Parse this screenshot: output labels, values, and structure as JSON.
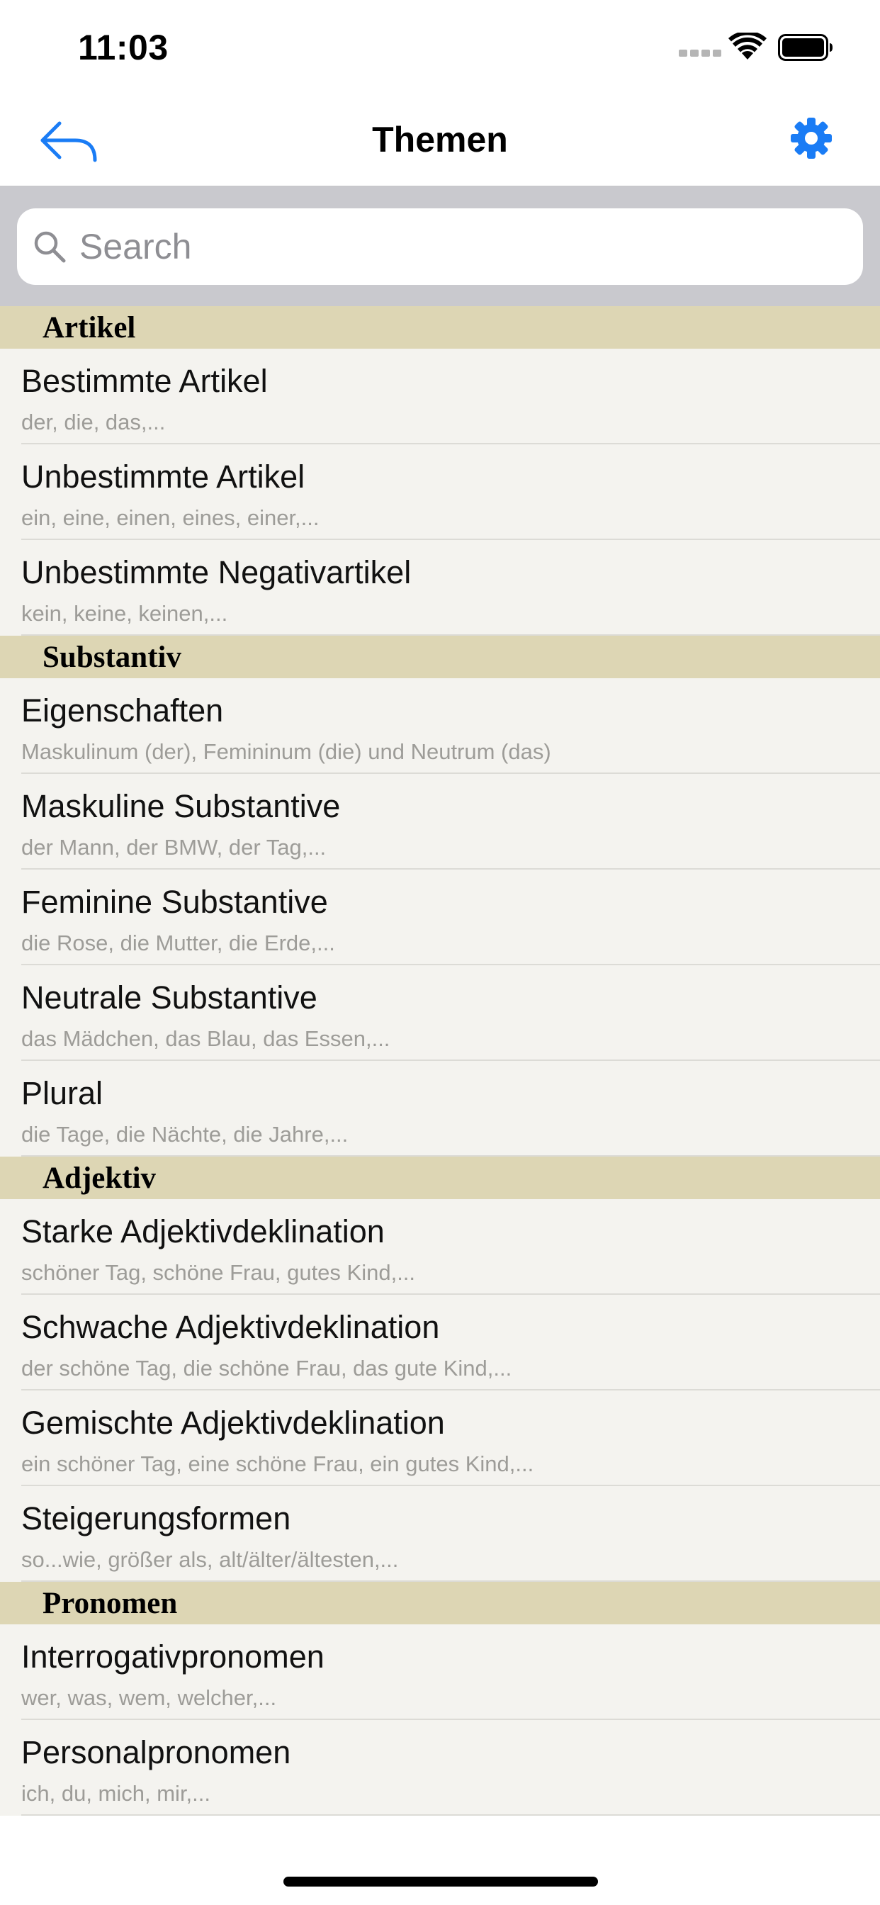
{
  "status_bar": {
    "time": "11:03"
  },
  "nav": {
    "title": "Themen",
    "back_icon": "back-arrow-icon",
    "settings_icon": "gear-icon"
  },
  "search": {
    "placeholder": "Search",
    "value": ""
  },
  "colors": {
    "accent": "#1a7cf5",
    "section_header_bg": "#ddd6b4",
    "list_bg": "#f4f3ef",
    "search_bg": "#c9c9ce"
  },
  "sections": [
    {
      "title": "Artikel",
      "items": [
        {
          "title": "Bestimmte Artikel",
          "subtitle": "der, die, das,..."
        },
        {
          "title": "Unbestimmte Artikel",
          "subtitle": "ein, eine, einen, eines, einer,..."
        },
        {
          "title": "Unbestimmte Negativartikel",
          "subtitle": "kein, keine, keinen,..."
        }
      ]
    },
    {
      "title": "Substantiv",
      "items": [
        {
          "title": "Eigenschaften",
          "subtitle": "Maskulinum (der), Femininum (die) und Neutrum (das)"
        },
        {
          "title": "Maskuline Substantive",
          "subtitle": "der Mann, der BMW, der Tag,..."
        },
        {
          "title": "Feminine Substantive",
          "subtitle": "die Rose, die Mutter, die Erde,..."
        },
        {
          "title": "Neutrale Substantive",
          "subtitle": "das Mädchen, das Blau, das Essen,..."
        },
        {
          "title": "Plural",
          "subtitle": "die Tage, die Nächte, die Jahre,..."
        }
      ]
    },
    {
      "title": "Adjektiv",
      "items": [
        {
          "title": "Starke Adjektivdeklination",
          "subtitle": "schöner Tag, schöne Frau, gutes Kind,..."
        },
        {
          "title": "Schwache Adjektivdeklination",
          "subtitle": "der schöne Tag, die schöne Frau, das gute Kind,..."
        },
        {
          "title": "Gemischte Adjektivdeklination",
          "subtitle": "ein schöner Tag, eine schöne Frau, ein gutes Kind,..."
        },
        {
          "title": "Steigerungsformen",
          "subtitle": "so...wie, größer als, alt/älter/ältesten,..."
        }
      ]
    },
    {
      "title": "Pronomen",
      "items": [
        {
          "title": "Interrogativpronomen",
          "subtitle": "wer, was, wem, welcher,..."
        },
        {
          "title": "Personalpronomen",
          "subtitle": "ich, du, mich, mir,..."
        }
      ]
    }
  ]
}
